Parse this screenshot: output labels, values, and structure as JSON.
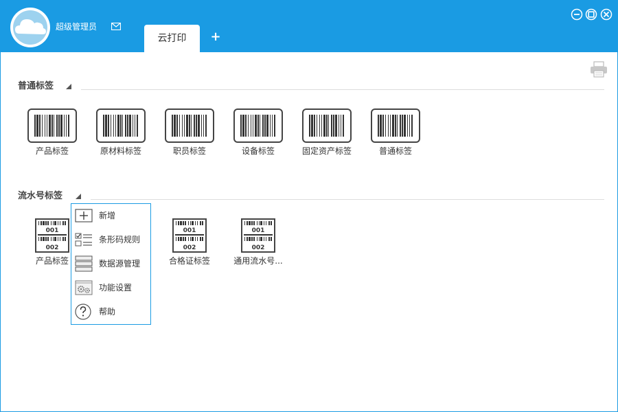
{
  "app": {
    "username": "超级管理员",
    "tabs": [
      {
        "label": "云打印",
        "active": true
      }
    ],
    "add_tab_label": "+",
    "accent_color": "#1a9be3"
  },
  "sections": [
    {
      "title": "普通标签",
      "items": [
        "产品标签",
        "原材料标签",
        "职员标签",
        "设备标签",
        "固定资产标签",
        "普通标签"
      ]
    },
    {
      "title": "流水号标签",
      "items": [
        "产品标签",
        "合格证标签",
        "通用流水号..."
      ],
      "serial_top": "001",
      "serial_bottom": "002"
    }
  ],
  "context_menu": {
    "items": [
      {
        "label": "新增",
        "icon": "plus-box-icon"
      },
      {
        "label": "条形码规则",
        "icon": "checklist-icon"
      },
      {
        "label": "数据源管理",
        "icon": "database-icon"
      },
      {
        "label": "功能设置",
        "icon": "settings-gears-icon"
      },
      {
        "label": "帮助",
        "icon": "help-circle-icon"
      }
    ]
  }
}
